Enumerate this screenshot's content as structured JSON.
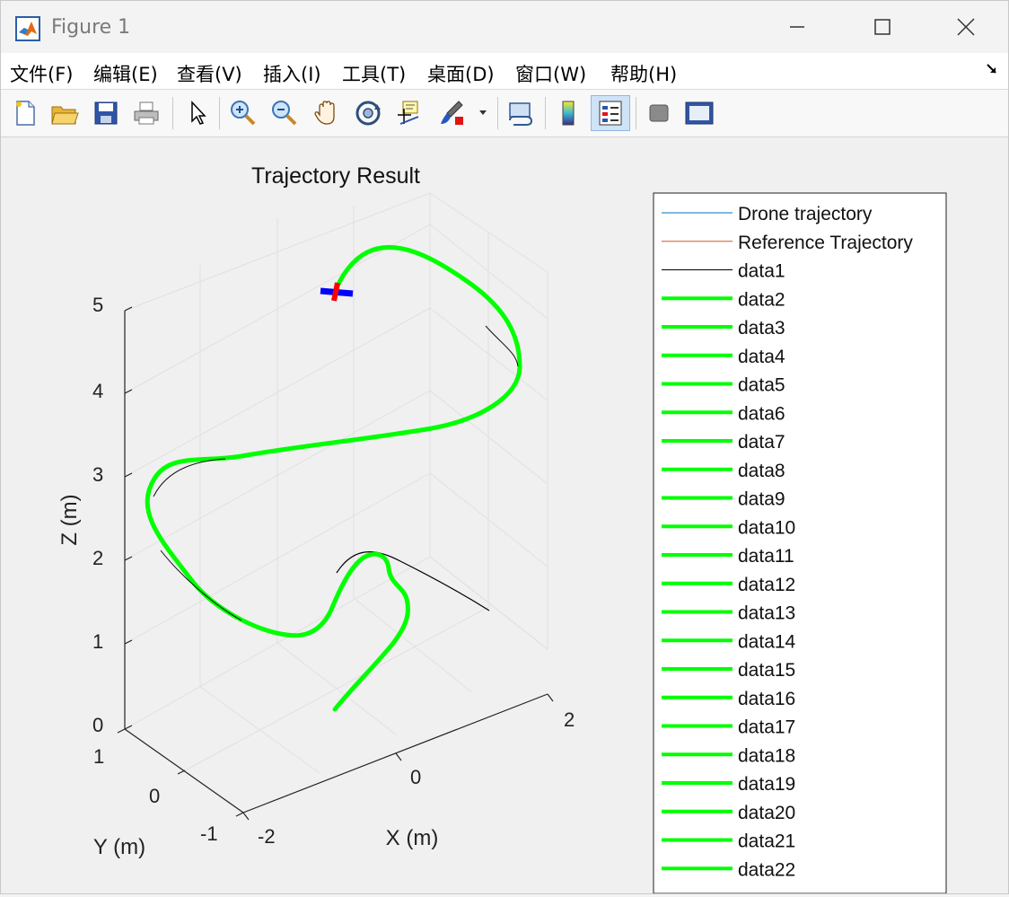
{
  "window": {
    "title": "Figure 1"
  },
  "menu": [
    "文件(F)",
    "编辑(E)",
    "查看(V)",
    "插入(I)",
    "工具(T)",
    "桌面(D)",
    "窗口(W)",
    "帮助(H)"
  ],
  "toolbar": {
    "icons": [
      "new-figure-icon",
      "open-file-icon",
      "save-icon",
      "print-icon",
      "pointer-icon",
      "zoom-in-icon",
      "zoom-out-icon",
      "pan-hand-icon",
      "rotate-3d-icon",
      "data-cursor-icon",
      "brush-icon",
      "link-plot-icon",
      "colorbar-icon",
      "legend-icon",
      "hide-tools-icon",
      "dock-figure-icon"
    ],
    "active": "legend-icon"
  },
  "chart_data": {
    "type": "line",
    "title": "Trajectory Result",
    "xlabel": "X (m)",
    "ylabel": "Y (m)",
    "zlabel": "Z (m)",
    "xticks": [
      "-2",
      "0",
      "2"
    ],
    "yticks": [
      "-1",
      "0",
      "1"
    ],
    "zticks": [
      "0",
      "1",
      "2",
      "3",
      "4",
      "5"
    ],
    "zlim": [
      0,
      5
    ],
    "grid": true,
    "legend_placement": "right",
    "legend": [
      {
        "name": "Drone trajectory",
        "color": "#0072bd",
        "width": 1
      },
      {
        "name": "Reference Trajectory",
        "color": "#d95319",
        "width": 1
      },
      {
        "name": "data1",
        "color": "#000000",
        "width": 1
      },
      {
        "name": "data2",
        "color": "#00ff00",
        "width": 4
      },
      {
        "name": "data3",
        "color": "#00ff00",
        "width": 4
      },
      {
        "name": "data4",
        "color": "#00ff00",
        "width": 4
      },
      {
        "name": "data5",
        "color": "#00ff00",
        "width": 4
      },
      {
        "name": "data6",
        "color": "#00ff00",
        "width": 4
      },
      {
        "name": "data7",
        "color": "#00ff00",
        "width": 4
      },
      {
        "name": "data8",
        "color": "#00ff00",
        "width": 4
      },
      {
        "name": "data9",
        "color": "#00ff00",
        "width": 4
      },
      {
        "name": "data10",
        "color": "#00ff00",
        "width": 4
      },
      {
        "name": "data11",
        "color": "#00ff00",
        "width": 4
      },
      {
        "name": "data12",
        "color": "#00ff00",
        "width": 4
      },
      {
        "name": "data13",
        "color": "#00ff00",
        "width": 4
      },
      {
        "name": "data14",
        "color": "#00ff00",
        "width": 4
      },
      {
        "name": "data15",
        "color": "#00ff00",
        "width": 4
      },
      {
        "name": "data16",
        "color": "#00ff00",
        "width": 4
      },
      {
        "name": "data17",
        "color": "#00ff00",
        "width": 4
      },
      {
        "name": "data18",
        "color": "#00ff00",
        "width": 4
      },
      {
        "name": "data19",
        "color": "#00ff00",
        "width": 4
      },
      {
        "name": "data20",
        "color": "#00ff00",
        "width": 4
      },
      {
        "name": "data21",
        "color": "#00ff00",
        "width": 4
      },
      {
        "name": "data22",
        "color": "#00ff00",
        "width": 4
      }
    ]
  }
}
